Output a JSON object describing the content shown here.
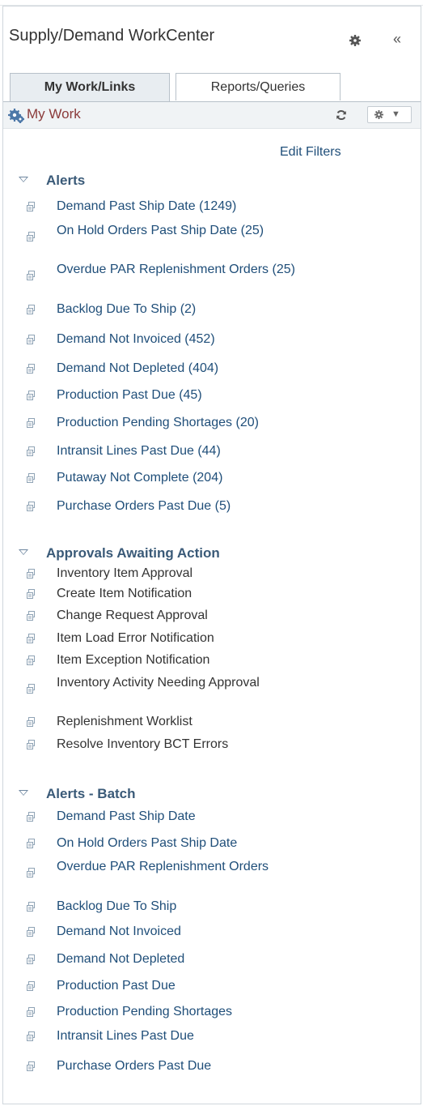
{
  "header": {
    "title": "Supply/Demand WorkCenter",
    "collapse_glyph": "«",
    "icons": {
      "settings": "gear-icon",
      "collapse": "double-chevron-left-icon"
    }
  },
  "tabs": [
    {
      "label": "My Work/Links",
      "active": true
    },
    {
      "label": "Reports/Queries",
      "active": false
    }
  ],
  "pagelet": {
    "title": "My Work",
    "actions_caret": "▼",
    "icons": {
      "title": "gears-icon",
      "refresh": "refresh-icon",
      "actions": "gear-icon"
    }
  },
  "edit_filters": "Edit Filters",
  "sections": [
    {
      "title": "Alerts",
      "items": [
        "Demand Past Ship Date (1249)",
        "On Hold Orders Past Ship Date (25)",
        "Overdue PAR Replenishment Orders (25)",
        "Backlog Due To Ship (2)",
        "Demand Not Invoiced (452)",
        "Demand Not Depleted (404)",
        "Production Past Due (45)",
        "Production Pending Shortages (20)",
        "Intransit Lines Past Due (44)",
        "Putaway Not Complete (204)",
        "Purchase Orders Past Due (5)"
      ]
    },
    {
      "title": "Approvals Awaiting Action",
      "items": [
        "Inventory Item Approval",
        "Create Item Notification",
        "Change Request Approval",
        "Item Load Error Notification",
        "Item Exception Notification",
        "Inventory Activity Needing Approval",
        "Replenishment Worklist",
        "Resolve Inventory BCT Errors"
      ]
    },
    {
      "title": "Alerts - Batch",
      "items": [
        "Demand Past Ship Date",
        "On Hold Orders Past Ship Date",
        "Overdue PAR Replenishment Orders",
        "Backlog Due To Ship",
        "Demand Not Invoiced",
        "Demand Not Depleted",
        "Production Past Due",
        "Production Pending Shortages",
        "Intransit Lines Past Due",
        "Purchase Orders Past Due"
      ]
    }
  ],
  "colors": {
    "link": "#1f4e79",
    "section": "#3a5a78",
    "pagelet_title": "#8b3b3b"
  }
}
